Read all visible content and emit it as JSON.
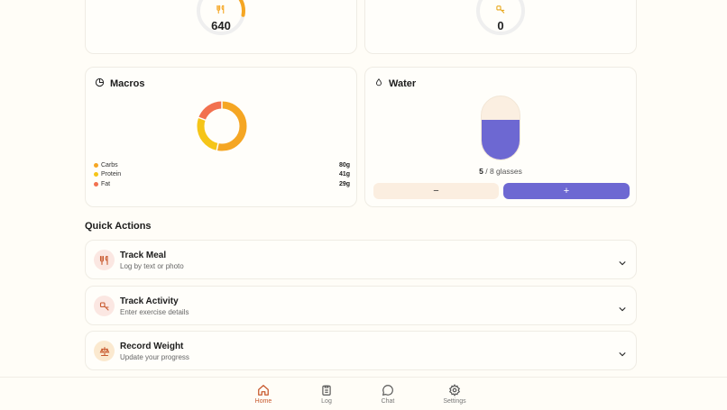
{
  "summary": {
    "calories_value": "640",
    "calories_progress": 0.28,
    "burned_value": "0",
    "burned_progress": 0
  },
  "macros": {
    "title": "Macros",
    "items": [
      {
        "name": "Carbs",
        "value": "80g",
        "grams": 80,
        "color": "#f5a623"
      },
      {
        "name": "Protein",
        "value": "41g",
        "grams": 41,
        "color": "#f5c518"
      },
      {
        "name": "Fat",
        "value": "29g",
        "grams": 29,
        "color": "#f2714f"
      }
    ]
  },
  "water": {
    "title": "Water",
    "current": "5",
    "goal_text": " / 8 glasses",
    "current_num": 5,
    "goal_num": 8,
    "minus_label": "−",
    "plus_label": "+",
    "fill_color": "#6d68d2"
  },
  "quick_actions": {
    "title": "Quick Actions",
    "items": [
      {
        "title": "Track Meal",
        "subtitle": "Log by text or photo",
        "icon": "utensils-icon"
      },
      {
        "title": "Track Activity",
        "subtitle": "Enter exercise details",
        "icon": "activity-icon"
      },
      {
        "title": "Record Weight",
        "subtitle": "Update your progress",
        "icon": "scale-icon"
      }
    ]
  },
  "nav": {
    "items": [
      {
        "label": "Home",
        "icon": "home-icon",
        "active": true
      },
      {
        "label": "Log",
        "icon": "clipboard-icon",
        "active": false
      },
      {
        "label": "Chat",
        "icon": "chat-icon",
        "active": false
      },
      {
        "label": "Settings",
        "icon": "gear-icon",
        "active": false
      }
    ]
  },
  "colors": {
    "accent": "#c85a2f",
    "orange": "#f5a623",
    "water": "#6d68d2",
    "ring_track": "#efefef"
  }
}
